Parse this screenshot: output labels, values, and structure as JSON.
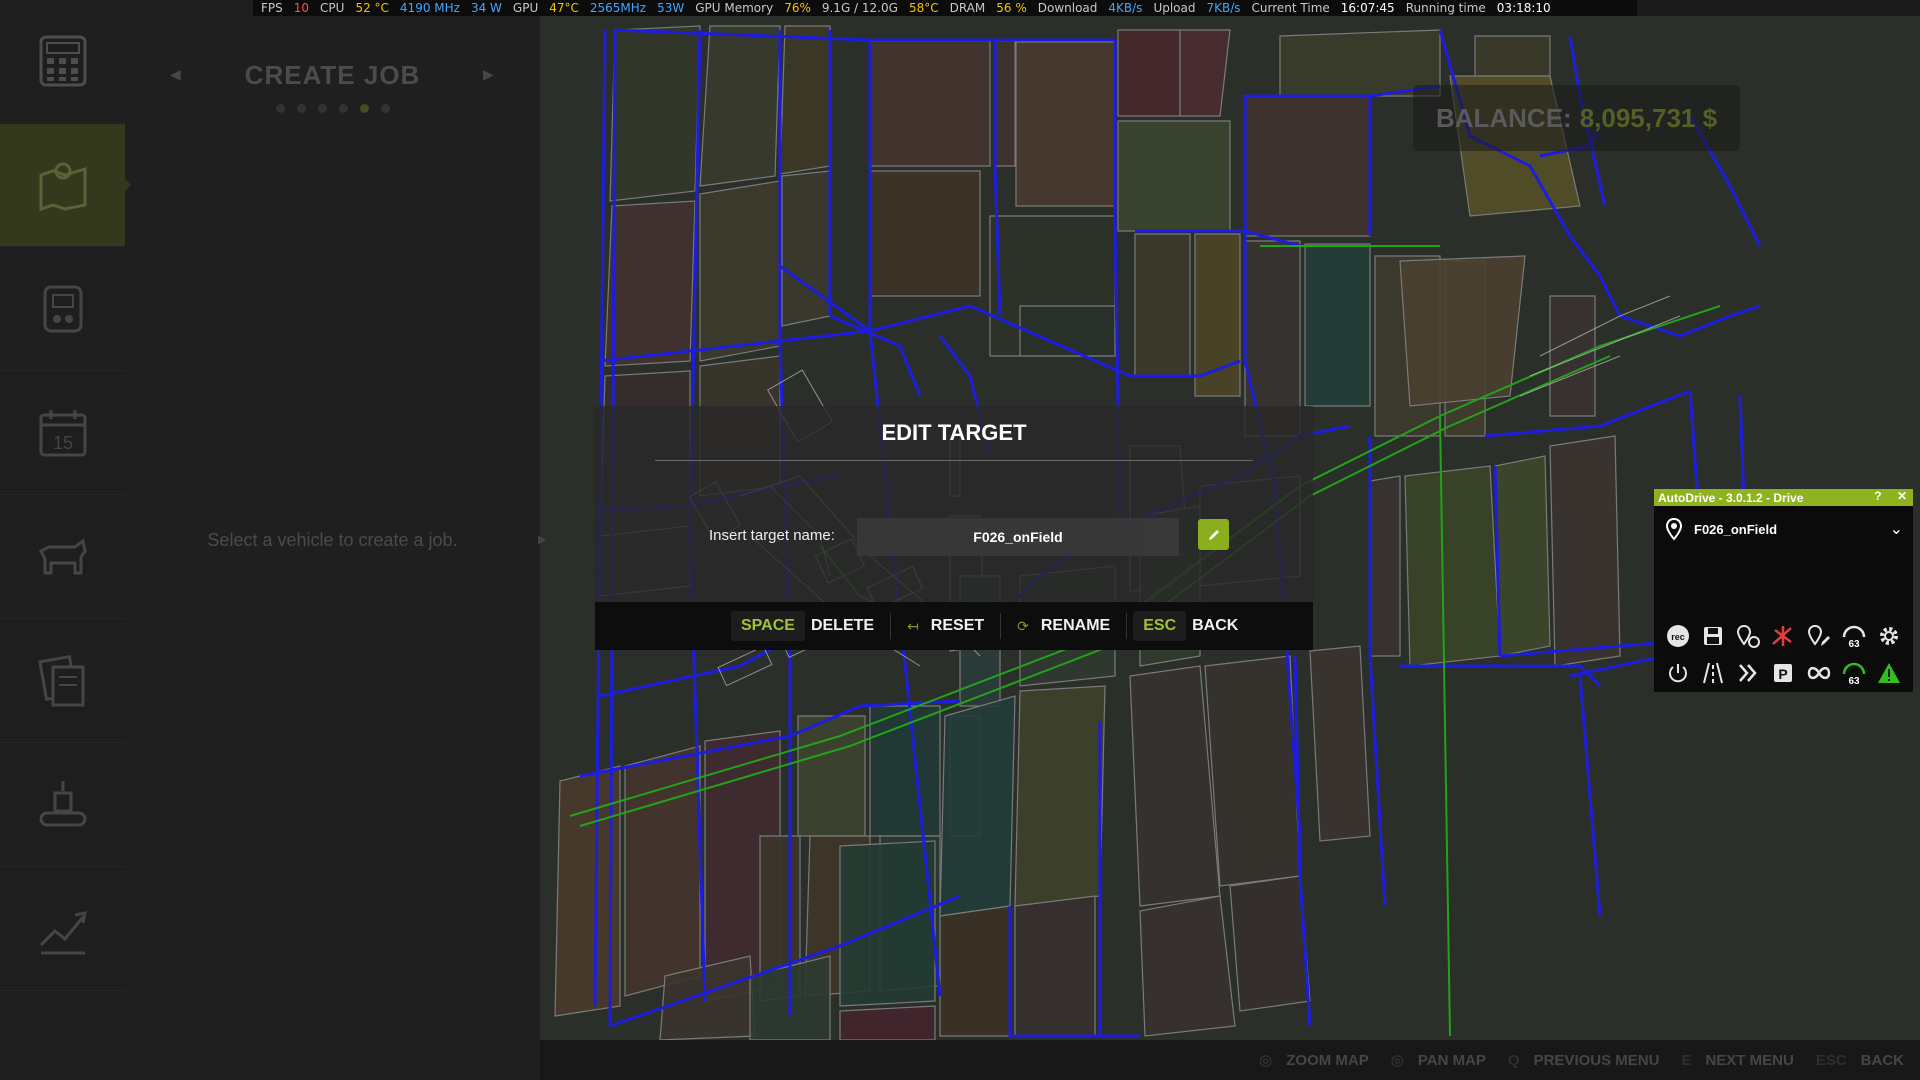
{
  "osd": {
    "fps_label": "FPS",
    "fps_value": "10",
    "cpu_label": "CPU",
    "cpu_temp": "52 °C",
    "cpu_freq": "4190 MHz",
    "cpu_power": "34 W",
    "gpu_label": "GPU",
    "gpu_temp": "47°C",
    "gpu_freq": "2565MHz",
    "gpu_power": "53W",
    "gpumem_label": "GPU Memory",
    "gpumem_pct": "76%",
    "gpumem_used": "9.1G / 12.0G",
    "gpumem_temp": "58°C",
    "dram_label": "DRAM",
    "dram_pct": "56 %",
    "download_label": "Download",
    "download_value": "4KB/s",
    "upload_label": "Upload",
    "upload_value": "7KB/s",
    "time_label": "Current Time",
    "time_value": "16:07:45",
    "runtime_label": "Running time",
    "runtime_value": "03:18:10"
  },
  "sidebar": {
    "items": [
      {
        "icon": "calculator-icon"
      },
      {
        "icon": "map-icon",
        "active": true
      },
      {
        "icon": "vehicle-icon"
      },
      {
        "icon": "calendar-icon",
        "day": "15"
      },
      {
        "icon": "animals-icon"
      },
      {
        "icon": "contracts-icon"
      },
      {
        "icon": "production-icon"
      },
      {
        "icon": "finances-icon"
      }
    ]
  },
  "job_panel": {
    "title": "CREATE JOB",
    "page_dots": 6,
    "current_dot": 5,
    "empty_text": "Select a vehicle to create a job."
  },
  "balance": {
    "label": "BALANCE:",
    "value": "8,095,731 $"
  },
  "dialog": {
    "title": "EDIT TARGET",
    "label": "Insert target name:",
    "input_value": "F026_onField"
  },
  "actions": [
    {
      "key": "SPACE",
      "label": "DELETE"
    },
    {
      "key": "↤",
      "label": "RESET"
    },
    {
      "key": "⟳",
      "label": "RENAME"
    },
    {
      "key": "ESC",
      "label": "BACK"
    }
  ],
  "autodrive": {
    "title": "AutoDrive - 3.0.1.2 - Drive",
    "help": "?",
    "close": "✕",
    "target": "F026_onField",
    "speed_a": "63",
    "speed_b": "63"
  },
  "bottom": [
    {
      "key": "◎",
      "label": "ZOOM MAP"
    },
    {
      "key": "◎",
      "label": "PAN MAP"
    },
    {
      "key": "Q",
      "label": "PREVIOUS MENU"
    },
    {
      "key": "E",
      "label": "NEXT MENU"
    },
    {
      "key": "ESC",
      "label": "BACK"
    }
  ],
  "colors": {
    "accent": "#8fb31f",
    "route_blue": "#1d1de0",
    "route_green": "#23a21a"
  }
}
